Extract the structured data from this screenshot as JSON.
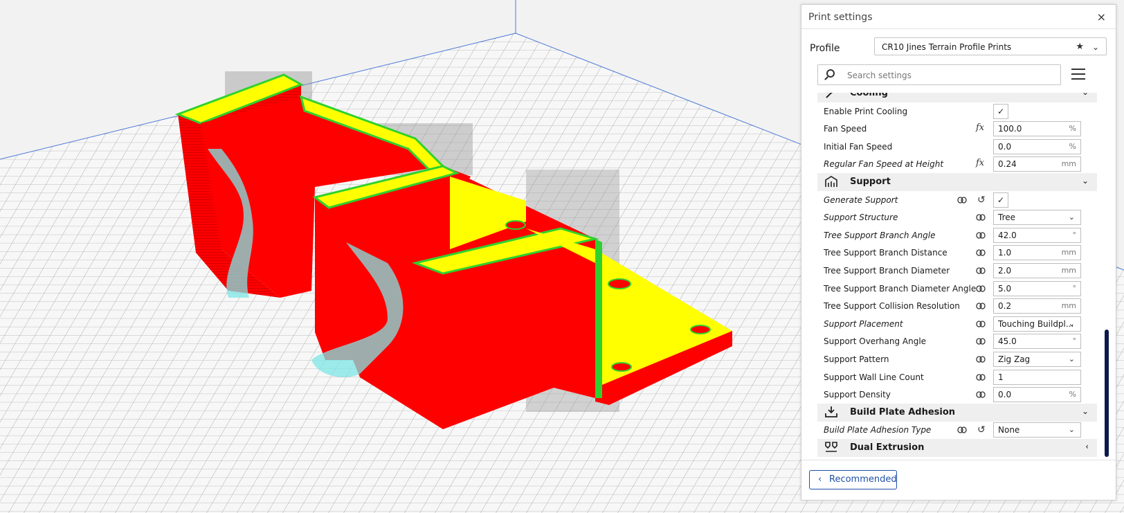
{
  "panel": {
    "title": "Print settings",
    "close_icon": "×",
    "profile_label": "Profile",
    "profile_value": "CR10 Jines Terrain Profile Prints",
    "search_placeholder": "Search settings",
    "recommended_label": "Recommended"
  },
  "settings": [
    {
      "type": "category",
      "label": "Cooling",
      "icon": "fan-icon",
      "expanded": true
    },
    {
      "type": "setting",
      "label": "Enable Print Cooling",
      "italic": false,
      "control": "checkbox",
      "checked": true
    },
    {
      "type": "setting",
      "label": "Fan Speed",
      "italic": false,
      "fx": true,
      "control": "input",
      "value": "100.0",
      "unit": "%"
    },
    {
      "type": "setting",
      "label": "Initial Fan Speed",
      "italic": false,
      "control": "input",
      "value": "0.0",
      "unit": "%"
    },
    {
      "type": "setting",
      "label": "Regular Fan Speed at Height",
      "italic": true,
      "fx": true,
      "control": "input",
      "value": "0.24",
      "unit": "mm"
    },
    {
      "type": "category",
      "label": "Support",
      "icon": "support-icon",
      "expanded": true
    },
    {
      "type": "setting",
      "label": "Generate Support",
      "italic": true,
      "link": true,
      "reset": true,
      "control": "checkbox",
      "checked": true
    },
    {
      "type": "setting",
      "label": "Support Structure",
      "italic": true,
      "link": true,
      "control": "select",
      "value": "Tree"
    },
    {
      "type": "setting",
      "label": "Tree Support Branch Angle",
      "italic": true,
      "link": true,
      "control": "input",
      "value": "42.0",
      "unit": "°"
    },
    {
      "type": "setting",
      "label": "Tree Support Branch Distance",
      "italic": false,
      "link": true,
      "control": "input",
      "value": "1.0",
      "unit": "mm"
    },
    {
      "type": "setting",
      "label": "Tree Support Branch Diameter",
      "italic": false,
      "link": true,
      "control": "input",
      "value": "2.0",
      "unit": "mm"
    },
    {
      "type": "setting",
      "label": "Tree Support Branch Diameter Angle",
      "italic": false,
      "link": true,
      "control": "input",
      "value": "5.0",
      "unit": "°"
    },
    {
      "type": "setting",
      "label": "Tree Support Collision Resolution",
      "italic": false,
      "link": true,
      "control": "input",
      "value": "0.2",
      "unit": "mm"
    },
    {
      "type": "setting",
      "label": "Support Placement",
      "italic": true,
      "link": true,
      "control": "select",
      "value": "Touching Buildpl..."
    },
    {
      "type": "setting",
      "label": "Support Overhang Angle",
      "italic": false,
      "link": true,
      "control": "input",
      "value": "45.0",
      "unit": "°"
    },
    {
      "type": "setting",
      "label": "Support Pattern",
      "italic": false,
      "link": true,
      "control": "select",
      "value": "Zig Zag"
    },
    {
      "type": "setting",
      "label": "Support Wall Line Count",
      "italic": false,
      "link": true,
      "control": "input",
      "value": "1",
      "unit": ""
    },
    {
      "type": "setting",
      "label": "Support Density",
      "italic": false,
      "link": true,
      "control": "input",
      "value": "0.0",
      "unit": "%"
    },
    {
      "type": "category",
      "label": "Build Plate Adhesion",
      "icon": "adhesion-icon",
      "expanded": true
    },
    {
      "type": "setting",
      "label": "Build Plate Adhesion Type",
      "italic": true,
      "link": true,
      "reset": true,
      "control": "select",
      "value": "None"
    },
    {
      "type": "category",
      "label": "Dual Extrusion",
      "icon": "dual-extrusion-icon",
      "expanded": false
    }
  ],
  "colors": {
    "model_red": "#ff0000",
    "model_yellow": "#ffff00",
    "model_green": "#2fd12f",
    "support_cyan": "#7fe6e6",
    "accent_blue": "#1f4fa8",
    "scrollbar": "#0a1a4a"
  }
}
